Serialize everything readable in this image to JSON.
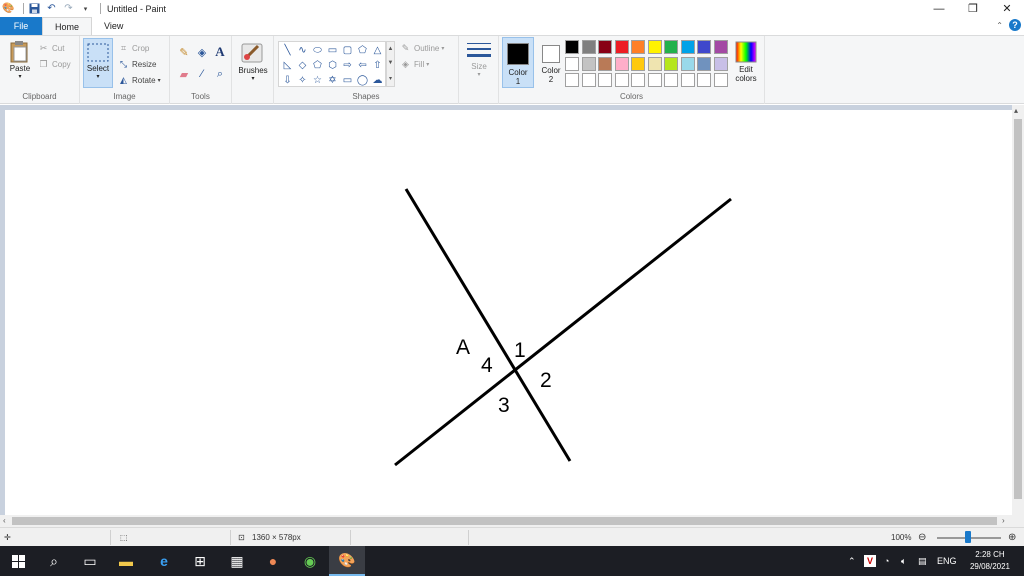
{
  "window": {
    "title": "Untitled - Paint",
    "controls": [
      "—",
      "❐",
      "✕"
    ]
  },
  "tabs": [
    {
      "label": "File"
    },
    {
      "label": "Home"
    },
    {
      "label": "View"
    }
  ],
  "ribbon": {
    "clipboard": {
      "label": "Clipboard",
      "paste": "Paste",
      "cut": "Cut",
      "copy": "Copy"
    },
    "image": {
      "label": "Image",
      "select": "Select",
      "crop": "Crop",
      "resize": "Resize",
      "rotate": "Rotate"
    },
    "tools": {
      "label": "Tools"
    },
    "brushes": {
      "label": "Brushes"
    },
    "shapes": {
      "label": "Shapes",
      "outline": "Outline",
      "fill": "Fill"
    },
    "size": {
      "label": "Size"
    },
    "colors": {
      "label": "Colors",
      "color1_label": "Color",
      "color1_num": "1",
      "color2_label": "Color",
      "color2_num": "2",
      "edit_label": "Edit",
      "edit_label2": "colors",
      "color1": "#000000",
      "color2": "#ffffff",
      "palette": [
        "#000000",
        "#7f7f7f",
        "#880015",
        "#ed1c24",
        "#ff7f27",
        "#fff200",
        "#22b14c",
        "#00a2e8",
        "#3f48cc",
        "#a349a4",
        "#ffffff",
        "#c3c3c3",
        "#b97a57",
        "#ffaec9",
        "#ffc90e",
        "#efe4b0",
        "#b5e61d",
        "#99d9ea",
        "#7092be",
        "#c8bfe7",
        "#ffffff",
        "#ffffff",
        "#ffffff",
        "#ffffff",
        "#ffffff",
        "#ffffff",
        "#ffffff",
        "#ffffff",
        "#ffffff",
        "#ffffff"
      ]
    }
  },
  "drawing": {
    "labels": {
      "A": "A",
      "one": "1",
      "two": "2",
      "three": "3",
      "four": "4"
    }
  },
  "status": {
    "dimensions": "1360 × 578px",
    "zoom": "100%"
  },
  "taskbar": {
    "language": "ENG",
    "time": "2:28 CH",
    "date": "29/08/2021"
  }
}
